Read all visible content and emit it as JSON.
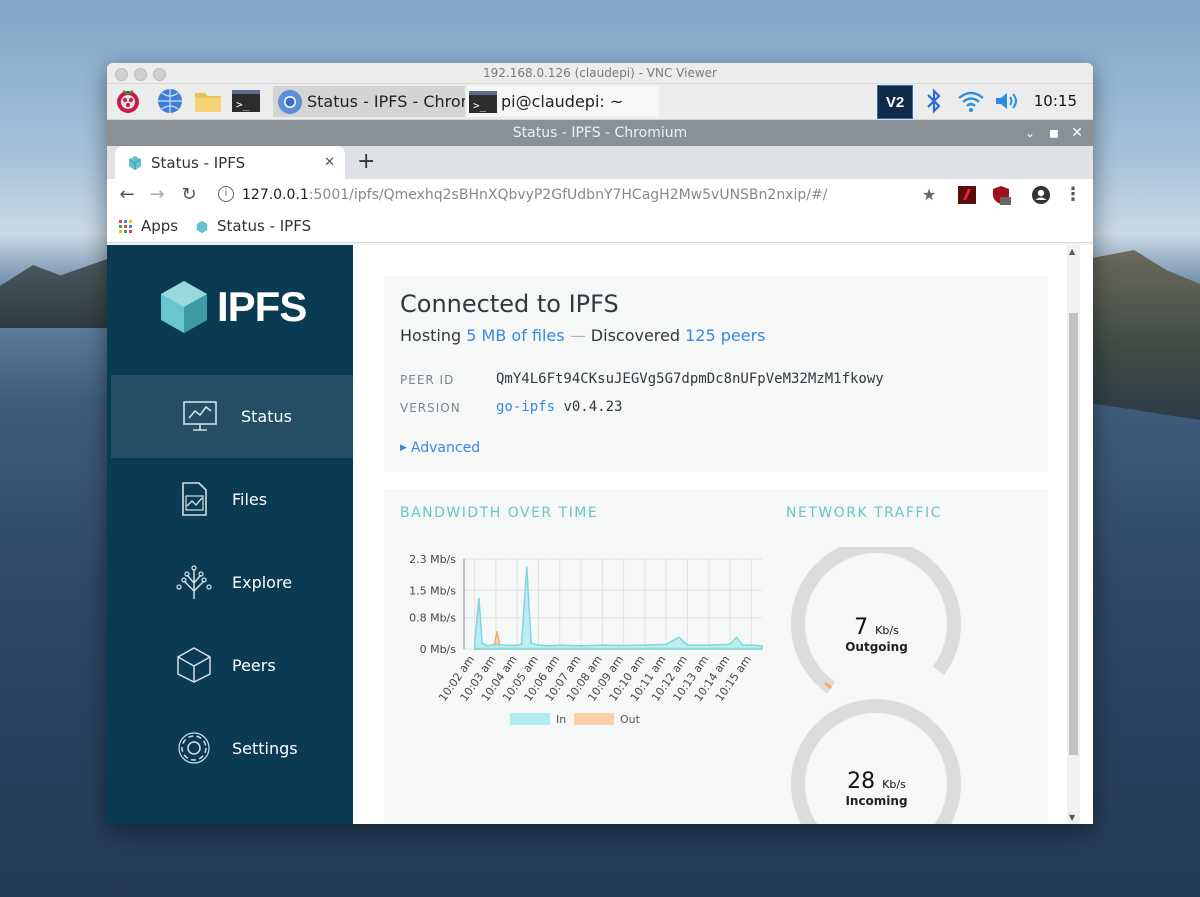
{
  "vnc": {
    "title": "192.168.0.126 (claudepi) - VNC Viewer"
  },
  "taskbar": {
    "tasks": [
      {
        "label": "Status - IPFS - Chrom..."
      },
      {
        "label": "pi@claudepi: ~"
      }
    ],
    "clock": "10:15"
  },
  "chrome": {
    "window_title": "Status - IPFS - Chromium",
    "tab_title": "Status - IPFS",
    "new_tab": "+",
    "url_host": "127.0.0.1",
    "url_rest": ":5001/ipfs/Qmexhq2sBHnXQbvyP2GfUdbnY7HCagH2Mw5vUNSBn2nxip/#/",
    "bookmarks": [
      {
        "label": "Apps"
      },
      {
        "label": "Status - IPFS"
      }
    ]
  },
  "sidebar": {
    "logo_text": "IPFS",
    "items": [
      {
        "label": "Status",
        "icon": "status-monitor-icon",
        "active": true
      },
      {
        "label": "Files",
        "icon": "files-icon"
      },
      {
        "label": "Explore",
        "icon": "explore-icon"
      },
      {
        "label": "Peers",
        "icon": "peers-cube-icon"
      },
      {
        "label": "Settings",
        "icon": "settings-gear-icon"
      }
    ]
  },
  "status": {
    "heading": "Connected to IPFS",
    "hosting_prefix": "Hosting",
    "hosting_link": "5 MB of files",
    "separator": "—",
    "discovered_prefix": "Discovered",
    "peers_link": "125 peers",
    "peer_id_label": "PEER ID",
    "peer_id": "QmY4L6Ft94CKsuJEGVg5G7dpmDc8nUFpVeM32MzM1fkowy",
    "version_label": "VERSION",
    "version_link": "go-ipfs",
    "version_num": "v0.4.23",
    "advanced": "Advanced"
  },
  "bandwidth": {
    "title": "BANDWIDTH OVER TIME",
    "traffic_title": "NETWORK TRAFFIC",
    "outgoing": {
      "value": "7",
      "unit": "Kb/s",
      "label": "Outgoing"
    },
    "incoming": {
      "value": "28",
      "unit": "Kb/s",
      "label": "Incoming"
    }
  },
  "chart_data": {
    "type": "line",
    "title": "BANDWIDTH OVER TIME",
    "y_ticks": [
      "2.3 Mb/s",
      "1.5 Mb/s",
      "0.8 Mb/s",
      "0 Mb/s"
    ],
    "ylim": [
      0,
      2.3
    ],
    "x_ticks": [
      "10:02 am",
      "10:03 am",
      "10:04 am",
      "10:05 am",
      "10:06 am",
      "10:07 am",
      "10:08 am",
      "10:09 am",
      "10:10 am",
      "10:11 am",
      "10:12 am",
      "10:13 am",
      "10:14 am",
      "10:15 am"
    ],
    "series": [
      {
        "name": "In",
        "color": "#b2ebf0",
        "stroke": "#7fd6dd",
        "points": [
          [
            0,
            0.1
          ],
          [
            0.2,
            1.3
          ],
          [
            0.35,
            0.15
          ],
          [
            0.6,
            0.08
          ],
          [
            1,
            0.12
          ],
          [
            1.4,
            0.1
          ],
          [
            1.8,
            0.09
          ],
          [
            2.0,
            0.1
          ],
          [
            2.2,
            0.12
          ],
          [
            2.45,
            2.1
          ],
          [
            2.65,
            0.15
          ],
          [
            3.0,
            0.1
          ],
          [
            3.5,
            0.08
          ],
          [
            4,
            0.1
          ],
          [
            5,
            0.08
          ],
          [
            6,
            0.1
          ],
          [
            7,
            0.09
          ],
          [
            8,
            0.1
          ],
          [
            9,
            0.12
          ],
          [
            9.6,
            0.3
          ],
          [
            10,
            0.1
          ],
          [
            11,
            0.1
          ],
          [
            12,
            0.12
          ],
          [
            12.3,
            0.3
          ],
          [
            12.6,
            0.1
          ],
          [
            13,
            0.1
          ],
          [
            13.5,
            0.08
          ]
        ]
      },
      {
        "name": "Out",
        "color": "#fbd0a8",
        "stroke": "#f4a860",
        "points": [
          [
            0,
            0.02
          ],
          [
            0.9,
            0.03
          ],
          [
            1.05,
            0.45
          ],
          [
            1.2,
            0.03
          ],
          [
            2,
            0.02
          ],
          [
            5,
            0.02
          ],
          [
            10,
            0.02
          ],
          [
            13.5,
            0.02
          ]
        ]
      }
    ],
    "grid": true,
    "legend": "bottom"
  }
}
